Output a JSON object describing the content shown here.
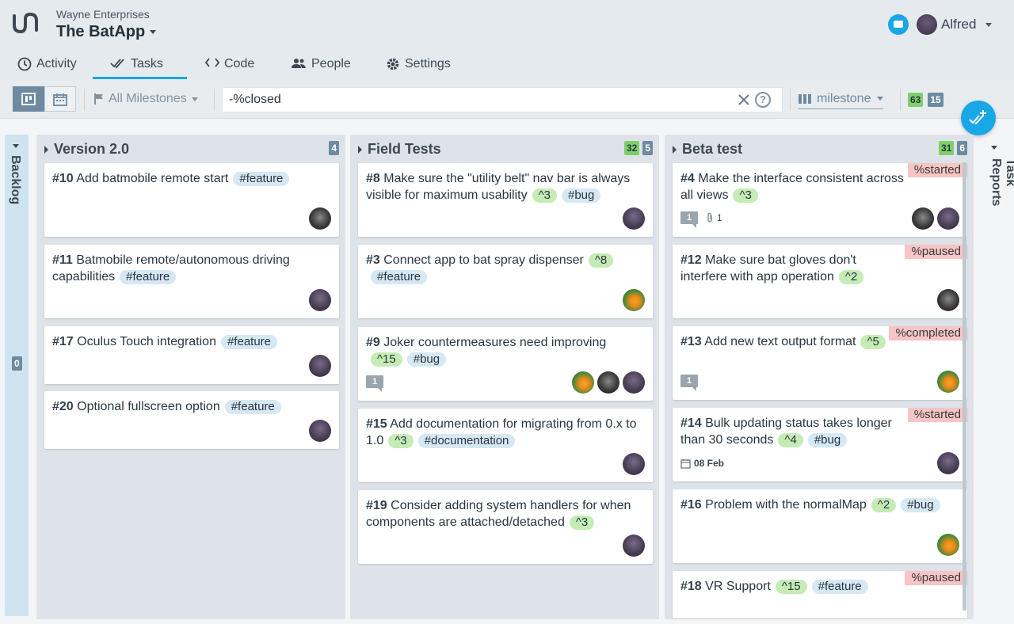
{
  "header": {
    "org": "Wayne Enterprises",
    "app": "The BatApp",
    "user": "Alfred"
  },
  "tabs": [
    {
      "label": "Activity",
      "icon": "clock-icon"
    },
    {
      "label": "Tasks",
      "icon": "double-check-icon",
      "active": true
    },
    {
      "label": "Code",
      "icon": "code-icon"
    },
    {
      "label": "People",
      "icon": "people-icon"
    },
    {
      "label": "Settings",
      "icon": "gear-icon"
    }
  ],
  "toolbar": {
    "milestones_label": "All Milestones",
    "search_value": "-%closed",
    "group_by": "milestone",
    "count_green": "63",
    "count_blue": "15"
  },
  "backlog": {
    "label": "Backlog",
    "count": "0"
  },
  "reports": {
    "label": "Task Reports"
  },
  "columns": [
    {
      "title": "Version 2.0",
      "badges": [
        {
          "text": "4",
          "color": "blue"
        }
      ],
      "cards": [
        {
          "num": "#10",
          "title": "Add batmobile remote start",
          "pts": "",
          "tags": [
            "#feature"
          ],
          "status": "",
          "avatars": [
            "dark"
          ]
        },
        {
          "num": "#11",
          "title": "Batmobile remote/autonomous driving capabilities",
          "pts": "",
          "tags": [
            "#feature"
          ],
          "status": "",
          "avatars": [
            "purple"
          ]
        },
        {
          "num": "#17",
          "title": "Oculus Touch integration",
          "pts": "",
          "tags": [
            "#feature"
          ],
          "status": "",
          "avatars": [
            "purple"
          ]
        },
        {
          "num": "#20",
          "title": "Optional fullscreen option",
          "pts": "",
          "tags": [
            "#feature"
          ],
          "status": "",
          "avatars": [
            "purple"
          ]
        }
      ]
    },
    {
      "title": "Field Tests",
      "badges": [
        {
          "text": "32",
          "color": "green"
        },
        {
          "text": "5",
          "color": "blue"
        }
      ],
      "cards": [
        {
          "num": "#8",
          "title": "Make sure the \"utility belt\" nav bar is always visible for maximum usability",
          "pts": "^3",
          "tags": [
            "#bug"
          ],
          "status": "",
          "avatars": [
            "purple"
          ]
        },
        {
          "num": "#3",
          "title": "Connect app to bat spray dispenser",
          "pts": "^8",
          "tags": [
            "#feature"
          ],
          "status": "",
          "avatars": [
            "bird"
          ]
        },
        {
          "num": "#9",
          "title": "Joker countermeasures need improving",
          "pts": "^15",
          "tags": [
            "#bug"
          ],
          "status": "",
          "comments": "1",
          "avatars": [
            "bird",
            "dark",
            "purple"
          ]
        },
        {
          "num": "#15",
          "title": "Add documentation for migrating from 0.x to 1.0",
          "pts": "^3",
          "tags": [
            "#documentation"
          ],
          "status": "",
          "avatars": [
            "purple"
          ]
        },
        {
          "num": "#19",
          "title": "Consider adding system handlers for when components are attached/detached",
          "pts": "^3",
          "tags": [],
          "status": "",
          "avatars": [
            "purple"
          ]
        }
      ]
    },
    {
      "title": "Beta test",
      "badges": [
        {
          "text": "31",
          "color": "green"
        },
        {
          "text": "6",
          "color": "blue"
        }
      ],
      "cards": [
        {
          "num": "#4",
          "title": "Make the interface consistent across all views",
          "pts": "^3",
          "tags": [],
          "status": "%started",
          "comments": "1",
          "attachments": "1",
          "avatars": [
            "dark",
            "purple"
          ]
        },
        {
          "num": "#12",
          "title": "Make sure bat gloves don't interfere with app operation",
          "pts": "^2",
          "tags": [],
          "status": "%paused",
          "avatars": [
            "dark"
          ]
        },
        {
          "num": "#13",
          "title": "Add new text output format",
          "pts": "^5",
          "tags": [],
          "status": "%completed",
          "comments": "1",
          "avatars": [
            "bird"
          ]
        },
        {
          "num": "#14",
          "title": "Bulk updating status takes longer than 30 seconds",
          "pts": "^4",
          "tags": [
            "#bug"
          ],
          "status": "%started",
          "due": "08 Feb",
          "avatars": [
            "purple"
          ]
        },
        {
          "num": "#16",
          "title": "Problem with the normalMap",
          "pts": "^2",
          "tags": [
            "#bug"
          ],
          "status": "",
          "avatars": [
            "bird"
          ]
        },
        {
          "num": "#18",
          "title": "VR Support",
          "pts": "^15",
          "tags": [
            "#feature"
          ],
          "status": "%paused",
          "avatars": []
        }
      ]
    }
  ],
  "colors": {
    "accent": "#1aa7e8",
    "green": "#7ed06a",
    "slate": "#6d8aa1",
    "status": "#f7c5c5"
  }
}
